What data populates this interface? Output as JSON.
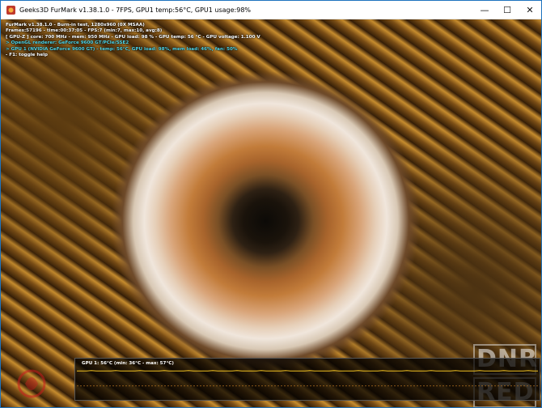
{
  "window": {
    "title": "Geeks3D FurMark v1.38.1.0 - 7FPS, GPU1 temp:56°C, GPU1 usage:98%",
    "minimize_glyph": "—",
    "maximize_glyph": "☐",
    "close_glyph": "✕"
  },
  "overlay": {
    "lines": [
      "FurMark v1.38.1.0 - Burn-in test, 1280x960 (0X MSAA)",
      "Frames:57196 - time:00:37:05 - FPS:7 (min:7, max:10, avg:8)",
      "[ GPU-Z ] core: 700 MHz - mem: 950 MHz - GPU load: 98 % - GPU temp: 56 °C - GPU voltage: 1.100 V",
      "> OpenGL renderer: GeForce 9600 GT/PCIe/SSE2",
      "> GPU 1 (NVIDIA GeForce 9600 GT) - temp: 56°C, GPU load: 98%, mem load: 46%, fan: 50%",
      "- F1: toggle help"
    ]
  },
  "graph": {
    "label": "GPU 1: 56°C (min: 36°C - max: 57°C)",
    "current_temp": 56,
    "min_temp": 36,
    "max_temp": 57
  },
  "watermark": {
    "line1": "DNR",
    "line2": "RED"
  },
  "colors": {
    "overlay_white": "#ffffff",
    "overlay_cyan": "#52d6e8",
    "graph_line": "#f0c020",
    "graph_guide": "#b07020"
  }
}
